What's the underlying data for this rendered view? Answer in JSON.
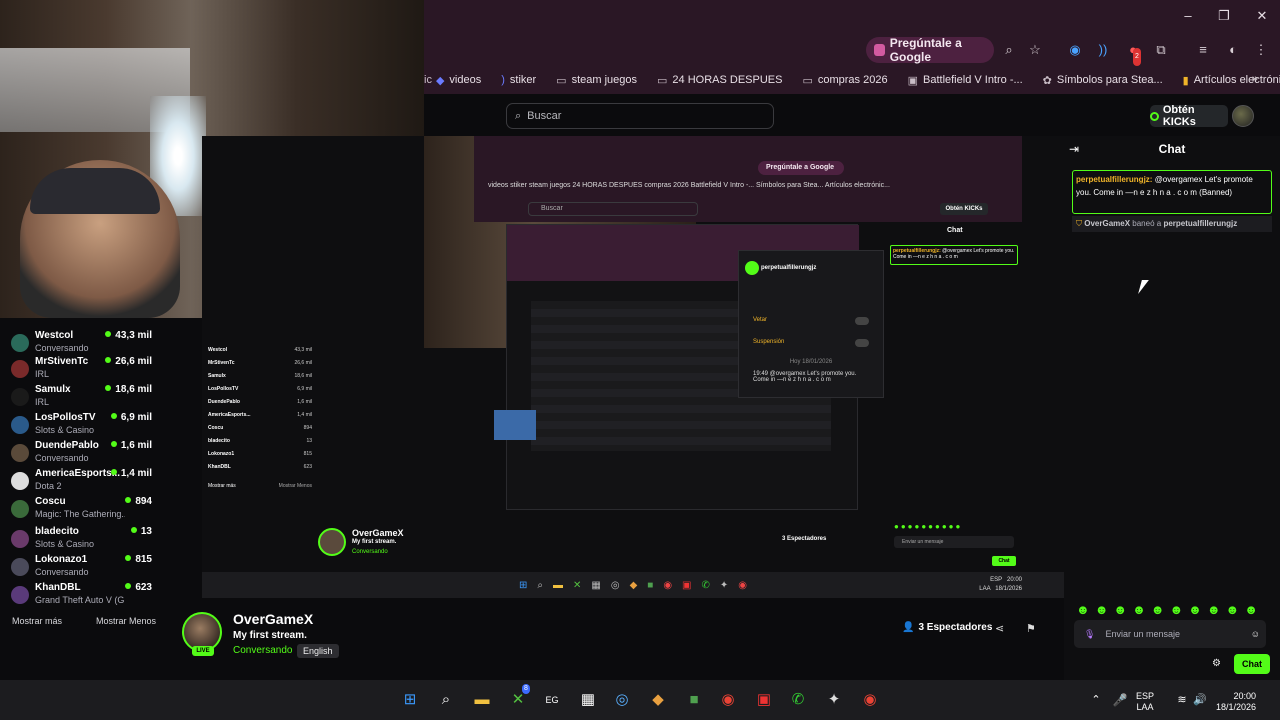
{
  "browser": {
    "ask_google": "Pregúntale a Google",
    "bookmarks": [
      "videos",
      "stiker",
      "steam juegos",
      "24 HORAS DESPUES",
      "compras 2026",
      "Battlefield V Intro -...",
      "Símbolos para Stea...",
      "Artículos electrónic..."
    ],
    "extension_badge": "2"
  },
  "kick": {
    "search_placeholder": "Buscar",
    "kicks_button": "Obtén KICKs"
  },
  "sidebar": {
    "channels": [
      {
        "name": "Westcol",
        "category": "Conversando",
        "viewers": "43,3 mil"
      },
      {
        "name": "MrStivenTc",
        "category": "IRL",
        "viewers": "26,6 mil"
      },
      {
        "name": "Samulx",
        "category": "IRL",
        "viewers": "18,6 mil"
      },
      {
        "name": "LosPollosTV",
        "category": "Slots & Casino",
        "viewers": "6,9 mil"
      },
      {
        "name": "DuendePablo",
        "category": "Conversando",
        "viewers": "1,6 mil"
      },
      {
        "name": "AmericaEsports...",
        "category": "Dota 2",
        "viewers": "1,4 mil"
      },
      {
        "name": "Coscu",
        "category": "Magic: The Gathering...",
        "viewers": "894"
      },
      {
        "name": "bladecito",
        "category": "Slots & Casino",
        "viewers": "13"
      },
      {
        "name": "Lokonazo1",
        "category": "Conversando",
        "viewers": "815"
      },
      {
        "name": "KhanDBL",
        "category": "Grand Theft Auto V (G...",
        "viewers": "623"
      }
    ],
    "show_more": "Mostrar más",
    "show_less": "Mostrar Menos"
  },
  "streamer": {
    "name": "OverGameX",
    "title": "My first stream.",
    "category": "Conversando",
    "language": "English",
    "live_badge": "LIVE",
    "spectators": "3 Espectadores"
  },
  "shared_screen": {
    "ask_google": "Pregúntale a Google",
    "bookmarks": "videos   stiker   steam juegos   24 HORAS DESPUES   compras 2026   Battlefield V Intro -...   Símbolos para Stea...   Artículos electrónic...",
    "search": "Buscar",
    "kicks": "Obtén KICKs",
    "chat_title": "Chat",
    "chat_user": "perpetualfillerungjz:",
    "chat_text": "@overgamex Let's promote you. Come in —n e z h n a . c o m",
    "mod_user": "perpetualfillerungjz",
    "mod_ban": "Vetar",
    "mod_timeout": "Suspensión",
    "mod_date": "Hoy 18/01/2026",
    "mod_msg": "19:49 @overgamex Let's promote you. Come in —n e z h n a . c o m",
    "list": [
      {
        "name": "Westcol",
        "viewers": "43,3 mil"
      },
      {
        "name": "MrStivenTc",
        "viewers": "26,6 mil"
      },
      {
        "name": "Samulx",
        "viewers": "18,6 mil"
      },
      {
        "name": "LosPollosTV",
        "viewers": "6,9 mil"
      },
      {
        "name": "DuendePablo",
        "viewers": "1,6 mil"
      },
      {
        "name": "AmericaEsports...",
        "viewers": "1,4 mil"
      },
      {
        "name": "Coscu",
        "viewers": "894"
      },
      {
        "name": "bladecito",
        "viewers": "13"
      },
      {
        "name": "Lokonazo1",
        "viewers": "815"
      },
      {
        "name": "KhanDBL",
        "viewers": "623"
      }
    ],
    "show_more": "Mostrar más",
    "show_less": "Mostrar Menos",
    "streamer_name": "OverGameX",
    "streamer_title": "My first stream.",
    "streamer_cat": "Conversando",
    "spectators": "3 Espectadores",
    "input": "Enviar un mensaje",
    "chat_button": "Chat",
    "tray_lang": "ESP",
    "tray_layout": "LAA",
    "tray_time": "20:00",
    "tray_date": "18/1/2026"
  },
  "chat": {
    "title": "Chat",
    "messages": [
      {
        "user": "perpetualfillerungjz:",
        "text": "@overgamex Let's promote you. Come in —n e z h n a . c o m (Banned)"
      }
    ],
    "ban_notice": {
      "moderator": "OverGameX",
      "action": "baneó a",
      "target": "perpetualfillerungjz"
    },
    "input_placeholder": "Enviar un mensaje",
    "send_button": "Chat"
  },
  "taskbar": {
    "lang": "ESP",
    "layout": "LAA",
    "time": "20:00",
    "date": "18/1/2026",
    "xbox_badge": "8"
  },
  "colors": {
    "kick_green": "#53fc18",
    "chrome_bar": "#2a1725",
    "username_yellow": "#f0b429"
  }
}
